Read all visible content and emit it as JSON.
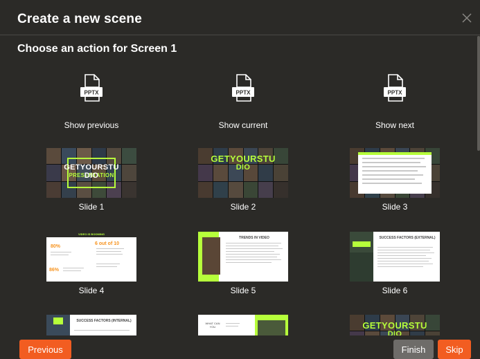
{
  "dialog": {
    "title": "Create a new scene",
    "subtitle": "Choose an action for Screen 1"
  },
  "actions": [
    {
      "label": "Show previous",
      "icon": "pptx-icon",
      "icon_text": "PPTX"
    },
    {
      "label": "Show current",
      "icon": "pptx-icon",
      "icon_text": "PPTX"
    },
    {
      "label": "Show next",
      "icon": "pptx-icon",
      "icon_text": "PPTX"
    }
  ],
  "slides": [
    {
      "label": "Slide 1",
      "text_top": "GETYOURSTU",
      "text_bottom": "DIO",
      "overlay": "PRESENTATION"
    },
    {
      "label": "Slide 2",
      "text_top": "GETYOURSTU",
      "text_bottom": "DIO"
    },
    {
      "label": "Slide 3"
    },
    {
      "label": "Slide 4",
      "header": "VIDEO IS BOOMING",
      "stat1": "80%",
      "stat2": "6 out of 10",
      "stat3": "86%"
    },
    {
      "label": "Slide 5",
      "heading": "TRENDS IN VIDEO"
    },
    {
      "label": "Slide 6",
      "heading": "SUCCESS FACTORS (EXTERNAL)"
    },
    {
      "heading": "SUCCESS FACTORS (INTERNAL)"
    },
    {
      "heading": "WHAT CAN YOU"
    },
    {
      "text_top": "GETYOURSTU",
      "text_bottom": "DIO"
    }
  ],
  "buttons": {
    "previous": "Previous",
    "finish": "Finish",
    "skip": "Skip"
  },
  "colors": {
    "background": "#2b2a27",
    "accent": "#f25d21",
    "finish": "#6e6c69",
    "lime": "#b6ff3b"
  }
}
